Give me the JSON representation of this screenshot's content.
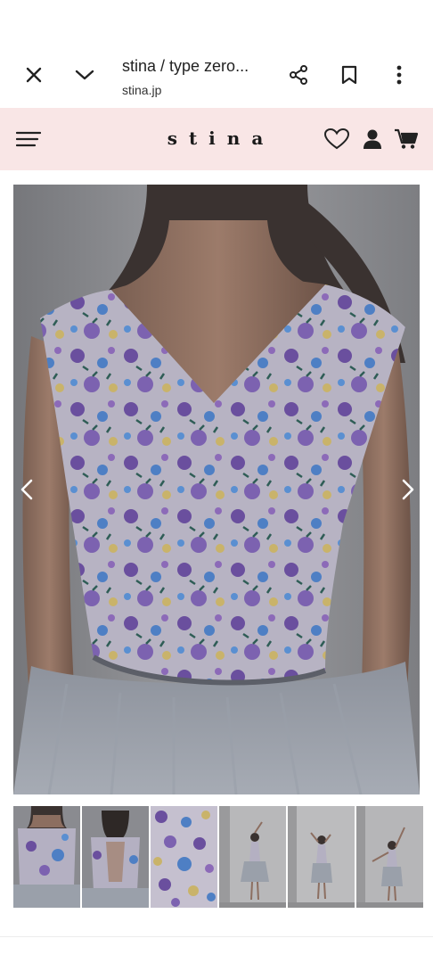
{
  "browser": {
    "title": "stina / type zero...",
    "url": "stina.jp",
    "icons": [
      "close-icon",
      "chevron-down-icon",
      "share-icon",
      "bookmark-icon",
      "more-vert-icon"
    ]
  },
  "site": {
    "logo": "stina",
    "header_bg": "#f9e6e6",
    "icons": [
      "menu-icon",
      "heart-icon",
      "account-icon",
      "cart-icon"
    ]
  },
  "gallery": {
    "main_image": "leotard-front-closeup",
    "thumbnails": [
      "leotard-front",
      "leotard-back",
      "fabric-pattern",
      "pose-1",
      "pose-2",
      "pose-3"
    ],
    "selected_thumbnail": 1
  }
}
